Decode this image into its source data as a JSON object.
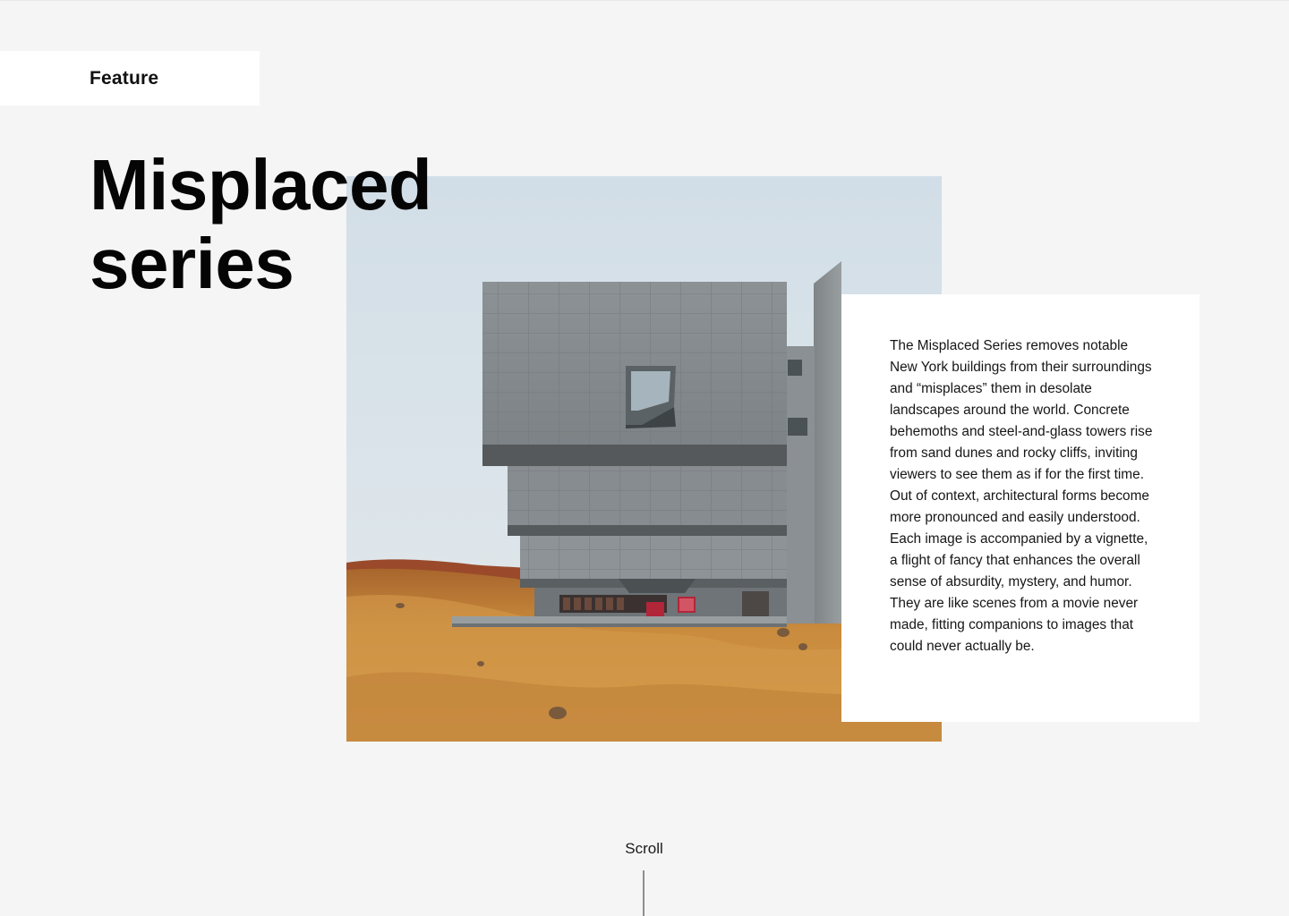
{
  "feature": {
    "label": "Feature"
  },
  "hero": {
    "title_line1": "Misplaced",
    "title_line2": "series"
  },
  "description": {
    "text": "The Misplaced Series removes notable New York buildings from their surroundings and “misplaces” them in desolate landscapes around the world. Concrete behemoths and steel-and-glass towers rise from sand dunes and rocky cliffs, inviting viewers to see them as if for the first time. Out of context, architectural forms become more pronounced and easily understood. Each image is accompanied by a vignette, a flight of fancy that enhances the overall sense of absurdity, mystery, and humor. They are like scenes from a movie never made, fitting companions to images that could never actually be."
  },
  "scroll": {
    "label": "Scroll"
  },
  "colors": {
    "background": "#f5f5f5",
    "card": "#ffffff",
    "sky": "#d8e2e9",
    "concrete": "#8d9396",
    "sand": "#c98a3a"
  }
}
